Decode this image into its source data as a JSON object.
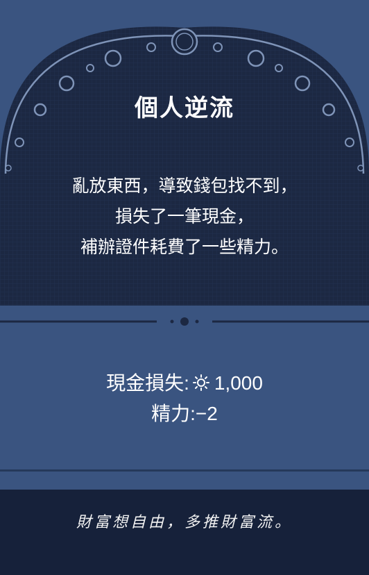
{
  "card": {
    "title": "個人逆流",
    "description_lines": [
      "亂放東西，導致錢包找不到，",
      "損失了一筆現金，",
      "補辦證件耗費了一些精力。"
    ],
    "effects": {
      "cash_label": "現金損失:",
      "cash_icon": "coin-icon",
      "cash_value": "1,000",
      "energy_line": "精力:−2"
    },
    "slogan": "財富想自由，多推財富流。"
  },
  "colors": {
    "card_blue": "#3a5480",
    "arch_dark": "#1b2640",
    "footer_dark": "#16213a",
    "ring_light": "#7f94b8"
  }
}
